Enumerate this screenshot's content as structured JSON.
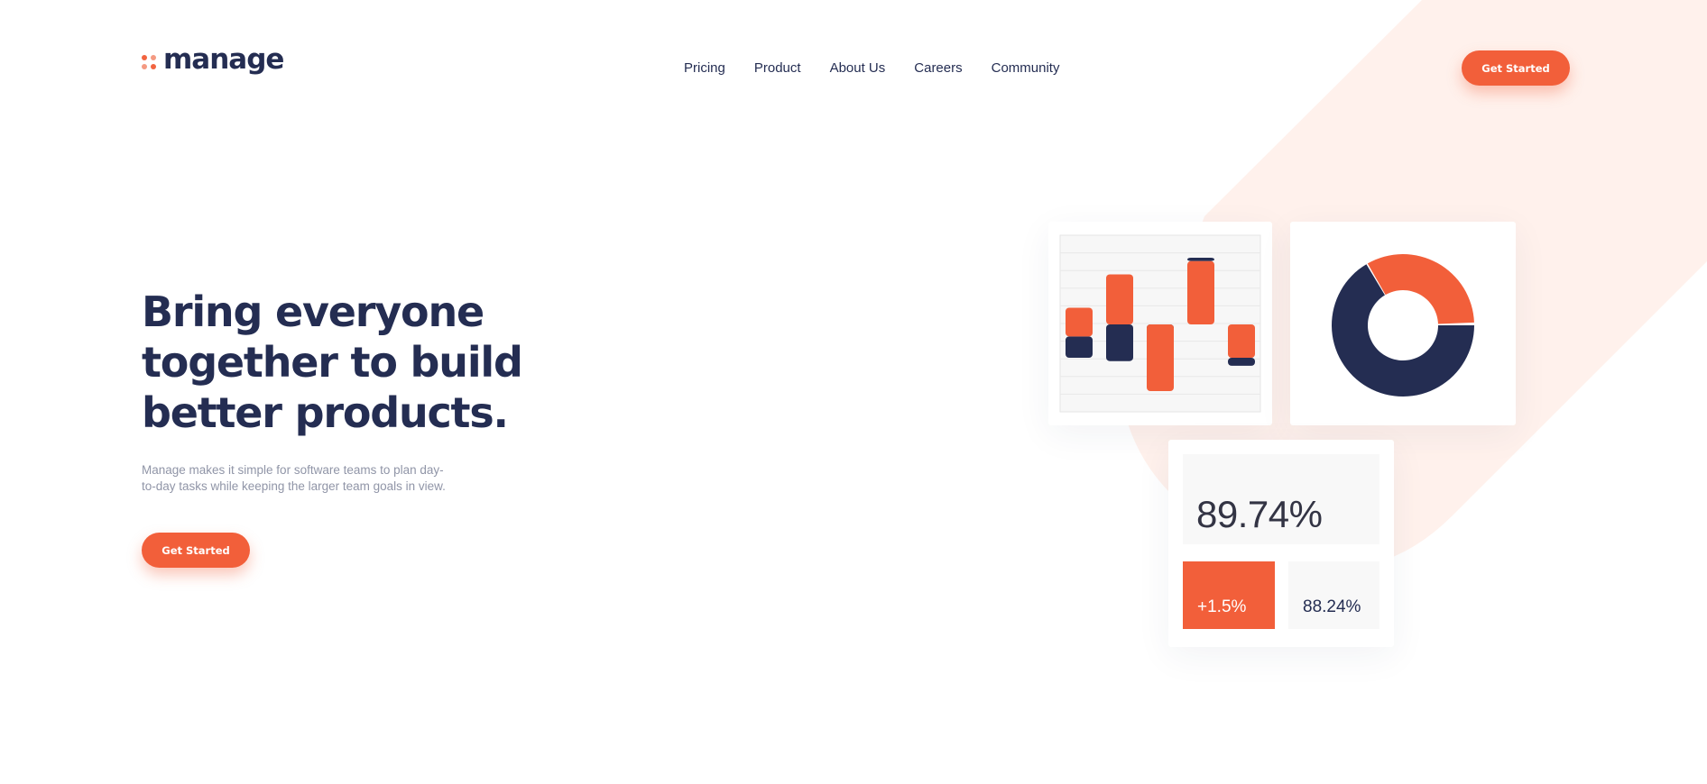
{
  "brand": {
    "name": "manage",
    "accent": "#f25f3a",
    "dark": "#242d52",
    "soft_background": "#fff1ec"
  },
  "nav": {
    "items": [
      "Pricing",
      "Product",
      "About Us",
      "Careers",
      "Community"
    ]
  },
  "header": {
    "cta_label": "Get Started"
  },
  "hero": {
    "title": "Bring everyone together to build better products.",
    "text": "Manage makes it simple for software teams to plan day-to-day tasks while keeping the larger team goals in view.",
    "cta_label": "Get Started"
  },
  "stats": {
    "big_value": "89.74%",
    "small_orange_value": "+1.5%",
    "small_grey_value": "88.24%"
  },
  "bar_chart": {
    "orange_segments": [
      [
        0.25,
        -0.18
      ],
      [
        0.75,
        0
      ],
      [
        0,
        -1
      ],
      [
        0.95,
        0
      ],
      [
        0,
        -0.5
      ]
    ],
    "navy_segments": [
      [
        -0.18,
        -0.5
      ],
      [
        0,
        -0.55
      ],
      [
        0,
        -0.38
      ],
      [
        1.0,
        0.95
      ],
      [
        -0.5,
        -0.62
      ]
    ]
  },
  "donut": {
    "orange_fraction": 0.24,
    "navy_fraction": 0.76
  }
}
